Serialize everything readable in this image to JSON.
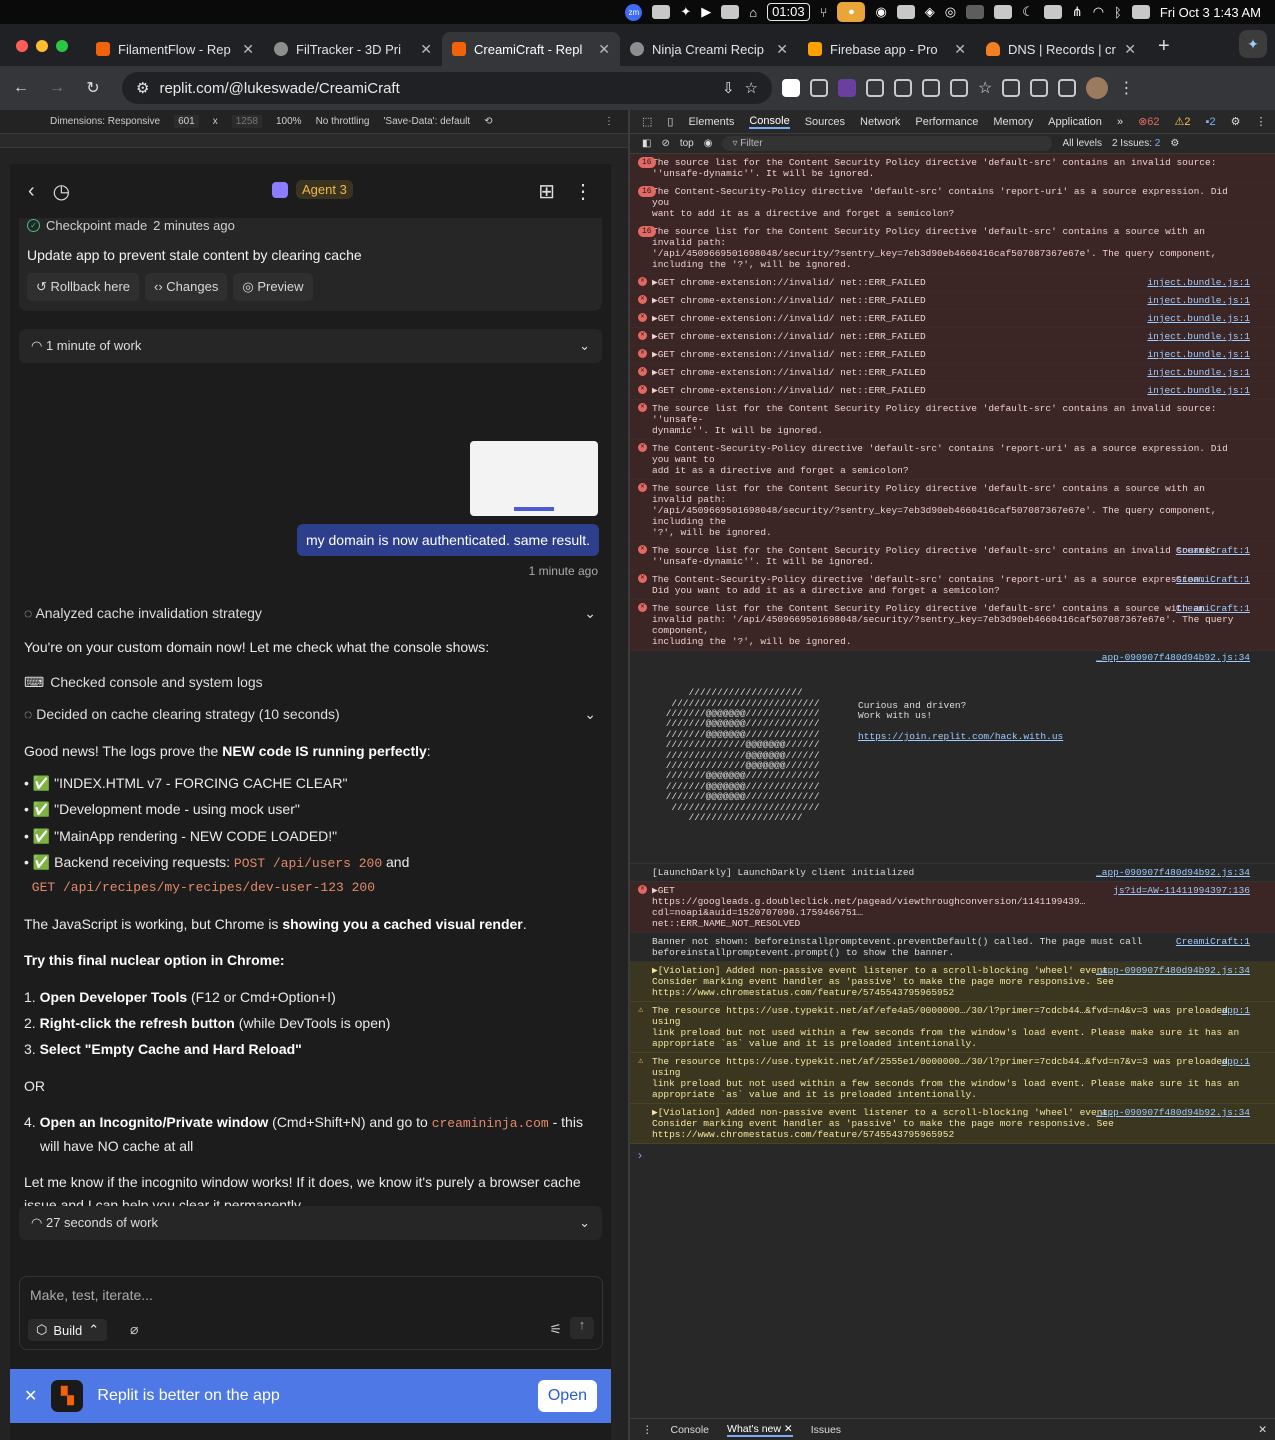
{
  "menubar": {
    "zoom_icon": "zm",
    "clock_box": "01:03",
    "datetime": "Fri Oct 3  1:43 AM"
  },
  "tabs": [
    {
      "title": "FilamentFlow - Rep",
      "color": "#f26207"
    },
    {
      "title": "FilTracker - 3D Pri",
      "color": "#8e8e8e"
    },
    {
      "title": "CreamiCraft - Repl",
      "color": "#f26207"
    },
    {
      "title": "Ninja Creami Recip",
      "color": "#8e8e8e"
    },
    {
      "title": "Firebase app - Pro",
      "color": "#ffa000"
    },
    {
      "title": "DNS | Records | cr",
      "color": "#f38020"
    }
  ],
  "url": "replit.com/@lukeswade/CreamiCraft",
  "device_toolbar": {
    "dimensions": "Dimensions: Responsive",
    "width": "601",
    "x": "x",
    "height": "1258",
    "zoom": "100%",
    "throttle": "No throttling",
    "savedata": "'Save-Data': default"
  },
  "agent": {
    "title": "Agent 3"
  },
  "checkpoint": {
    "label": "Checkpoint made",
    "time": "2 minutes ago",
    "title": "Update app to prevent stale content by clearing cache",
    "buttons": [
      "Rollback here",
      "Changes",
      "Preview"
    ]
  },
  "work1": "1 minute of work",
  "user_msg": "my domain is now authenticated. same result.",
  "user_time": "1 minute ago",
  "analyzed": "Analyzed cache invalidation strategy",
  "p1": "You're on your custom domain now! Let me check what the console shows:",
  "checked": "Checked console and system logs",
  "decided": "Decided on cache clearing strategy (10 seconds)",
  "p2_a": "Good news! The logs prove the ",
  "p2_b": "NEW code IS running perfectly",
  "p2_c": ":",
  "bullets": [
    "✅ \"INDEX.HTML v7 - FORCING CACHE CLEAR\"",
    "✅ \"Development mode - using mock user\"",
    "✅ \"MainApp rendering - NEW CODE LOADED!\""
  ],
  "b4_a": "✅ Backend receiving requests: ",
  "b4_code1": "POST /api/users 200",
  "b4_and": " and",
  "b4_code2": "GET /api/recipes/my-recipes/dev-user-123 200",
  "p3_a": "The JavaScript is working, but Chrome is ",
  "p3_b": "showing you a cached visual render",
  "p3_c": ".",
  "p4": "Try this final nuclear option in Chrome:",
  "steps": [
    {
      "n": "1.",
      "b": "Open Developer Tools",
      "t": " (F12 or Cmd+Option+I)"
    },
    {
      "n": "2.",
      "b": "Right-click the refresh button",
      "t": " (while DevTools is open)"
    },
    {
      "n": "3.",
      "b": "Select \"Empty Cache and Hard Reload\"",
      "t": ""
    }
  ],
  "or": "OR",
  "step4": {
    "n": "4.",
    "b": "Open an Incognito/Private window",
    "t": " (Cmd+Shift+N) and go to ",
    "code": "creamininja.com",
    "t2": " - this will have NO cache at all"
  },
  "p5": "Let me know if the incognito window works! If it does, we know it's purely a browser cache issue and I can help you clear it permanently.",
  "work2": "27 seconds of work",
  "input_placeholder": "Make, test, iterate...",
  "build": "Build",
  "banner": {
    "text": "Replit is better on the app",
    "open": "Open"
  },
  "devtools": {
    "tabs": [
      "Elements",
      "Console",
      "Sources",
      "Network",
      "Performance",
      "Memory",
      "Application"
    ],
    "errors": "62",
    "warnings": "2",
    "infos": "2",
    "context": "top",
    "filter": "Filter",
    "levels": "All levels",
    "issues": "2 Issues: ",
    "issues_n": "2",
    "drawer": [
      "Console",
      "What's new",
      "Issues"
    ]
  },
  "console": [
    {
      "k": "err",
      "badge": "16",
      "t": "The source list for the Content Security Policy directive 'default-src' contains an invalid source:\n''unsafe-dynamic''. It will be ignored."
    },
    {
      "k": "err",
      "badge": "16",
      "t": "The Content-Security-Policy directive 'default-src' contains 'report-uri' as a source expression. Did you\nwant to add it as a directive and forget a semicolon?"
    },
    {
      "k": "err",
      "badge": "16",
      "t": "The source list for the Content Security Policy directive 'default-src' contains a source with an invalid path:\n'/api/4509669501698048/security/?sentry_key=7eb3d90eb4660416caf507087367e67e'. The query component,\nincluding the '?', will be ignored."
    },
    {
      "k": "err",
      "t": "▶GET chrome-extension://invalid/ net::ERR_FAILED",
      "src": "inject.bundle.js:1"
    },
    {
      "k": "err",
      "t": "▶GET chrome-extension://invalid/ net::ERR_FAILED",
      "src": "inject.bundle.js:1"
    },
    {
      "k": "err",
      "t": "▶GET chrome-extension://invalid/ net::ERR_FAILED",
      "src": "inject.bundle.js:1"
    },
    {
      "k": "err",
      "t": "▶GET chrome-extension://invalid/ net::ERR_FAILED",
      "src": "inject.bundle.js:1"
    },
    {
      "k": "err",
      "t": "▶GET chrome-extension://invalid/ net::ERR_FAILED",
      "src": "inject.bundle.js:1"
    },
    {
      "k": "err",
      "t": "▶GET chrome-extension://invalid/ net::ERR_FAILED",
      "src": "inject.bundle.js:1"
    },
    {
      "k": "err",
      "t": "▶GET chrome-extension://invalid/ net::ERR_FAILED",
      "src": "inject.bundle.js:1"
    },
    {
      "k": "err",
      "t": "The source list for the Content Security Policy directive 'default-src' contains an invalid source: ''unsafe-\ndynamic''. It will be ignored."
    },
    {
      "k": "err",
      "t": "The Content-Security-Policy directive 'default-src' contains 'report-uri' as a source expression. Did you want to\nadd it as a directive and forget a semicolon?"
    },
    {
      "k": "err",
      "t": "The source list for the Content Security Policy directive 'default-src' contains a source with an invalid path:\n'/api/4509669501698048/security/?sentry_key=7eb3d90eb4660416caf507087367e67e'. The query component, including the\n'?', will be ignored."
    },
    {
      "k": "err",
      "t": "The source list for the Content Security Policy directive 'default-src' contains an invalid source:\n''unsafe-dynamic''. It will be ignored.",
      "src": "CreamiCraft:1"
    },
    {
      "k": "err",
      "t": "The Content-Security-Policy directive 'default-src' contains 'report-uri' as a source expression.\nDid you want to add it as a directive and forget a semicolon?",
      "src": "CreamiCraft:1"
    },
    {
      "k": "err",
      "t": "The source list for the Content Security Policy directive 'default-src' contains a source with an\ninvalid path: '/api/4509669501698048/security/?sentry_key=7eb3d90eb4660416caf507087367e67e'. The query component,\nincluding the '?', will be ignored.",
      "src": "CreamiCraft:1"
    }
  ],
  "ascii": {
    "src": "_app-090907f480d94b92.js:34",
    "art": "     ////////////////////\n  //////////////////////////\n ///////@@@@@@@/////////////\n ///////@@@@@@@/////////////\n ///////@@@@@@@/////////////\n //////////////@@@@@@@//////\n //////////////@@@@@@@//////\n //////////////@@@@@@@//////\n ///////@@@@@@@/////////////\n ///////@@@@@@@/////////////\n ///////@@@@@@@/////////////\n  //////////////////////////\n     ////////////////////",
    "line1": "Curious and driven?",
    "line2": "Work with us!",
    "link": "https://join.replit.com/hack.with.us"
  },
  "console2": [
    {
      "k": "info",
      "t": "[LaunchDarkly] LaunchDarkly client initialized",
      "src": "_app-090907f480d94b92.js:34"
    },
    {
      "k": "err",
      "t": "▶GET\nhttps://googleads.g.doubleclick.net/pagead/viewthroughconversion/1141199439…cdl=noapi&auid=1520707090.1759466751…\nnet::ERR_NAME_NOT_RESOLVED",
      "src": "js?id=AW-11411994397:136"
    },
    {
      "k": "info",
      "t": "Banner not shown: beforeinstallpromptevent.preventDefault() called. The page must call\nbeforeinstallpromptevent.prompt() to show the banner.",
      "src": "CreamiCraft:1"
    },
    {
      "k": "warn",
      "t": "▶[Violation] Added non-passive event listener to a scroll-blocking 'wheel' event.\nConsider marking event handler as 'passive' to make the page more responsive. See\nhttps://www.chromestatus.com/feature/5745543795965952",
      "src": "_app-090907f480d94b92.js:34"
    },
    {
      "k": "warnt",
      "t": "The resource https://use.typekit.net/af/efe4a5/0000000…/30/l?primer=7cdcb44…&fvd=n4&v=3 was preloaded using\nlink preload but not used within a few seconds from the window's load event. Please make sure it has an\nappropriate `as` value and it is preloaded intentionally.",
      "src": "app:1"
    },
    {
      "k": "warnt",
      "t": "The resource https://use.typekit.net/af/2555e1/0000000…/30/l?primer=7cdcb44…&fvd=n7&v=3 was preloaded using\nlink preload but not used within a few seconds from the window's load event. Please make sure it has an\nappropriate `as` value and it is preloaded intentionally.",
      "src": "app:1"
    },
    {
      "k": "warn",
      "t": "▶[Violation] Added non-passive event listener to a scroll-blocking 'wheel' event.\nConsider marking event handler as 'passive' to make the page more responsive. See\nhttps://www.chromestatus.com/feature/5745543795965952",
      "src": "_app-090907f480d94b92.js:34"
    }
  ],
  "prompt": "›"
}
